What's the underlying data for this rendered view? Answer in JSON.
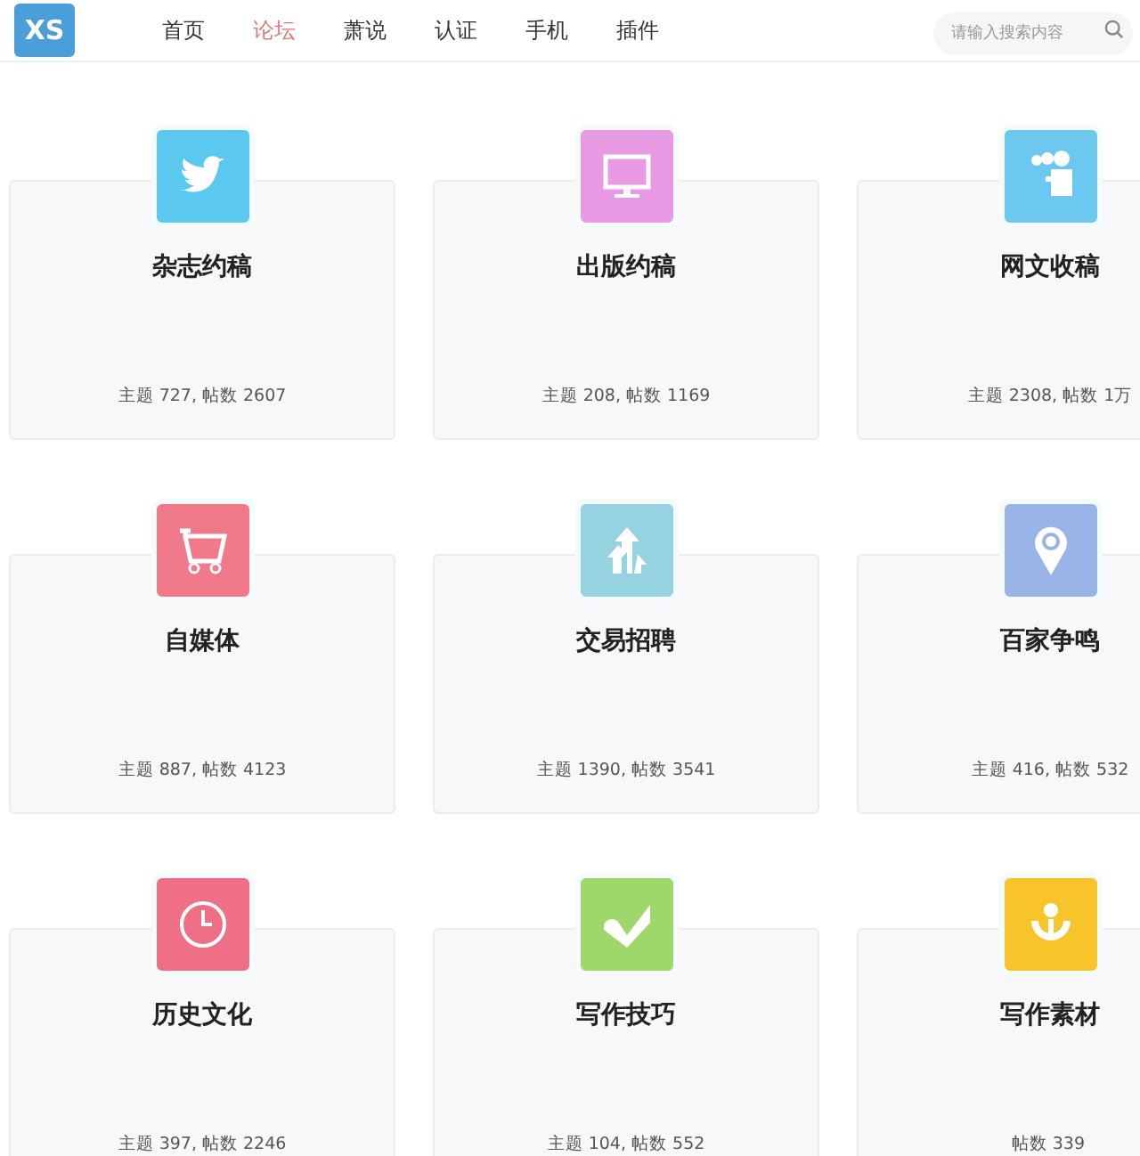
{
  "logo": {
    "text": "XS"
  },
  "nav": [
    {
      "label": "首页",
      "selected": false
    },
    {
      "label": "论坛",
      "selected": true
    },
    {
      "label": "萧说",
      "selected": false
    },
    {
      "label": "认证",
      "selected": false
    },
    {
      "label": "手机",
      "selected": false
    },
    {
      "label": "插件",
      "selected": false
    }
  ],
  "search": {
    "placeholder": "请输入搜索内容"
  },
  "forums": [
    {
      "color": "#5bc9ef",
      "title": "杂志约稿",
      "stats": "主题 727, 帖数 2607"
    },
    {
      "color": "#e89be4",
      "title": "出版约稿",
      "stats": "主题 208, 帖数 1169"
    },
    {
      "color": "#6cc8ef",
      "title": "网文收稿",
      "stats": "主题 2308, 帖数 1万"
    },
    {
      "color": "#f07a8a",
      "title": "自媒体",
      "stats": "主题 887, 帖数 4123"
    },
    {
      "color": "#96d3e0",
      "title": "交易招聘",
      "stats": "主题 1390, 帖数 3541"
    },
    {
      "color": "#98b3e6",
      "title": "百家争鸣",
      "stats": "主题 416, 帖数 532"
    },
    {
      "color": "#ef7086",
      "title": "历史文化",
      "stats": "主题 397, 帖数 2246"
    },
    {
      "color": "#9ed86a",
      "title": "写作技巧",
      "stats": "主题 104, 帖数 552"
    },
    {
      "color": "#f7c52a",
      "title": "写作素材",
      "stats": "帖数 339"
    }
  ]
}
